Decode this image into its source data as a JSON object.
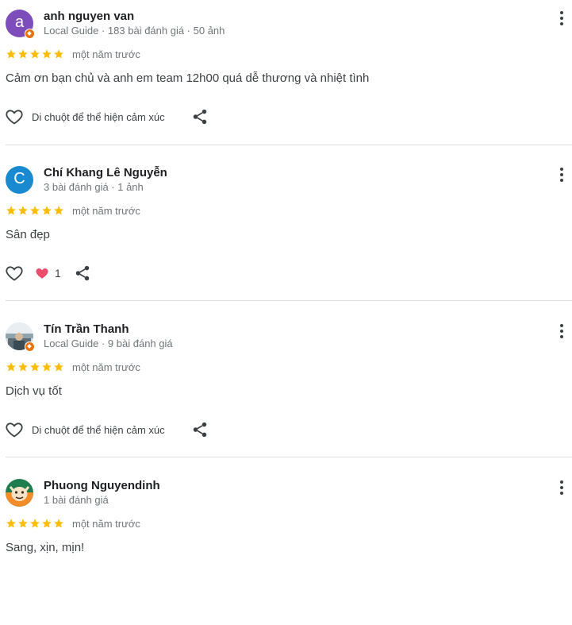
{
  "colors": {
    "star": "#fbbc04",
    "reaction_heart": "#ea4c6a",
    "avatar_r1": "#7c4dbb",
    "avatar_r2": "#1a8ad0",
    "local_guide_badge": "#e8710a"
  },
  "icons": {
    "more": "more-vert-icon",
    "like": "heart-outline-icon",
    "share": "share-icon",
    "reaction": "heart-filled-icon",
    "star": "star-icon"
  },
  "reviews": [
    {
      "avatar_letter": "a",
      "name": "anh nguyen van",
      "meta": "Local Guide · 183 bài đánh giá · 50 ảnh",
      "rating": 5,
      "date": "một năm trước",
      "text": "Cảm ơn bạn chủ và anh em team 12h00 quá dễ thương và nhiệt tình",
      "react_hint": "Di chuột để thể hiện cảm xúc"
    },
    {
      "avatar_letter": "C",
      "name": "Chí Khang Lê Nguyễn",
      "meta": "3 bài đánh giá · 1 ảnh",
      "rating": 5,
      "date": "một năm trước",
      "text": "Sân đẹp",
      "reaction_count": "1"
    },
    {
      "name": "Tín Trần Thanh",
      "meta": "Local Guide · 9 bài đánh giá",
      "rating": 5,
      "date": "một năm trước",
      "text": "Dịch vụ tốt",
      "react_hint": "Di chuột để thể hiện cảm xúc"
    },
    {
      "name": "Phuong Nguyendinh",
      "meta": "1 bài đánh giá",
      "rating": 5,
      "date": "một năm trước",
      "text": "Sang, xịn, mịn!"
    }
  ]
}
